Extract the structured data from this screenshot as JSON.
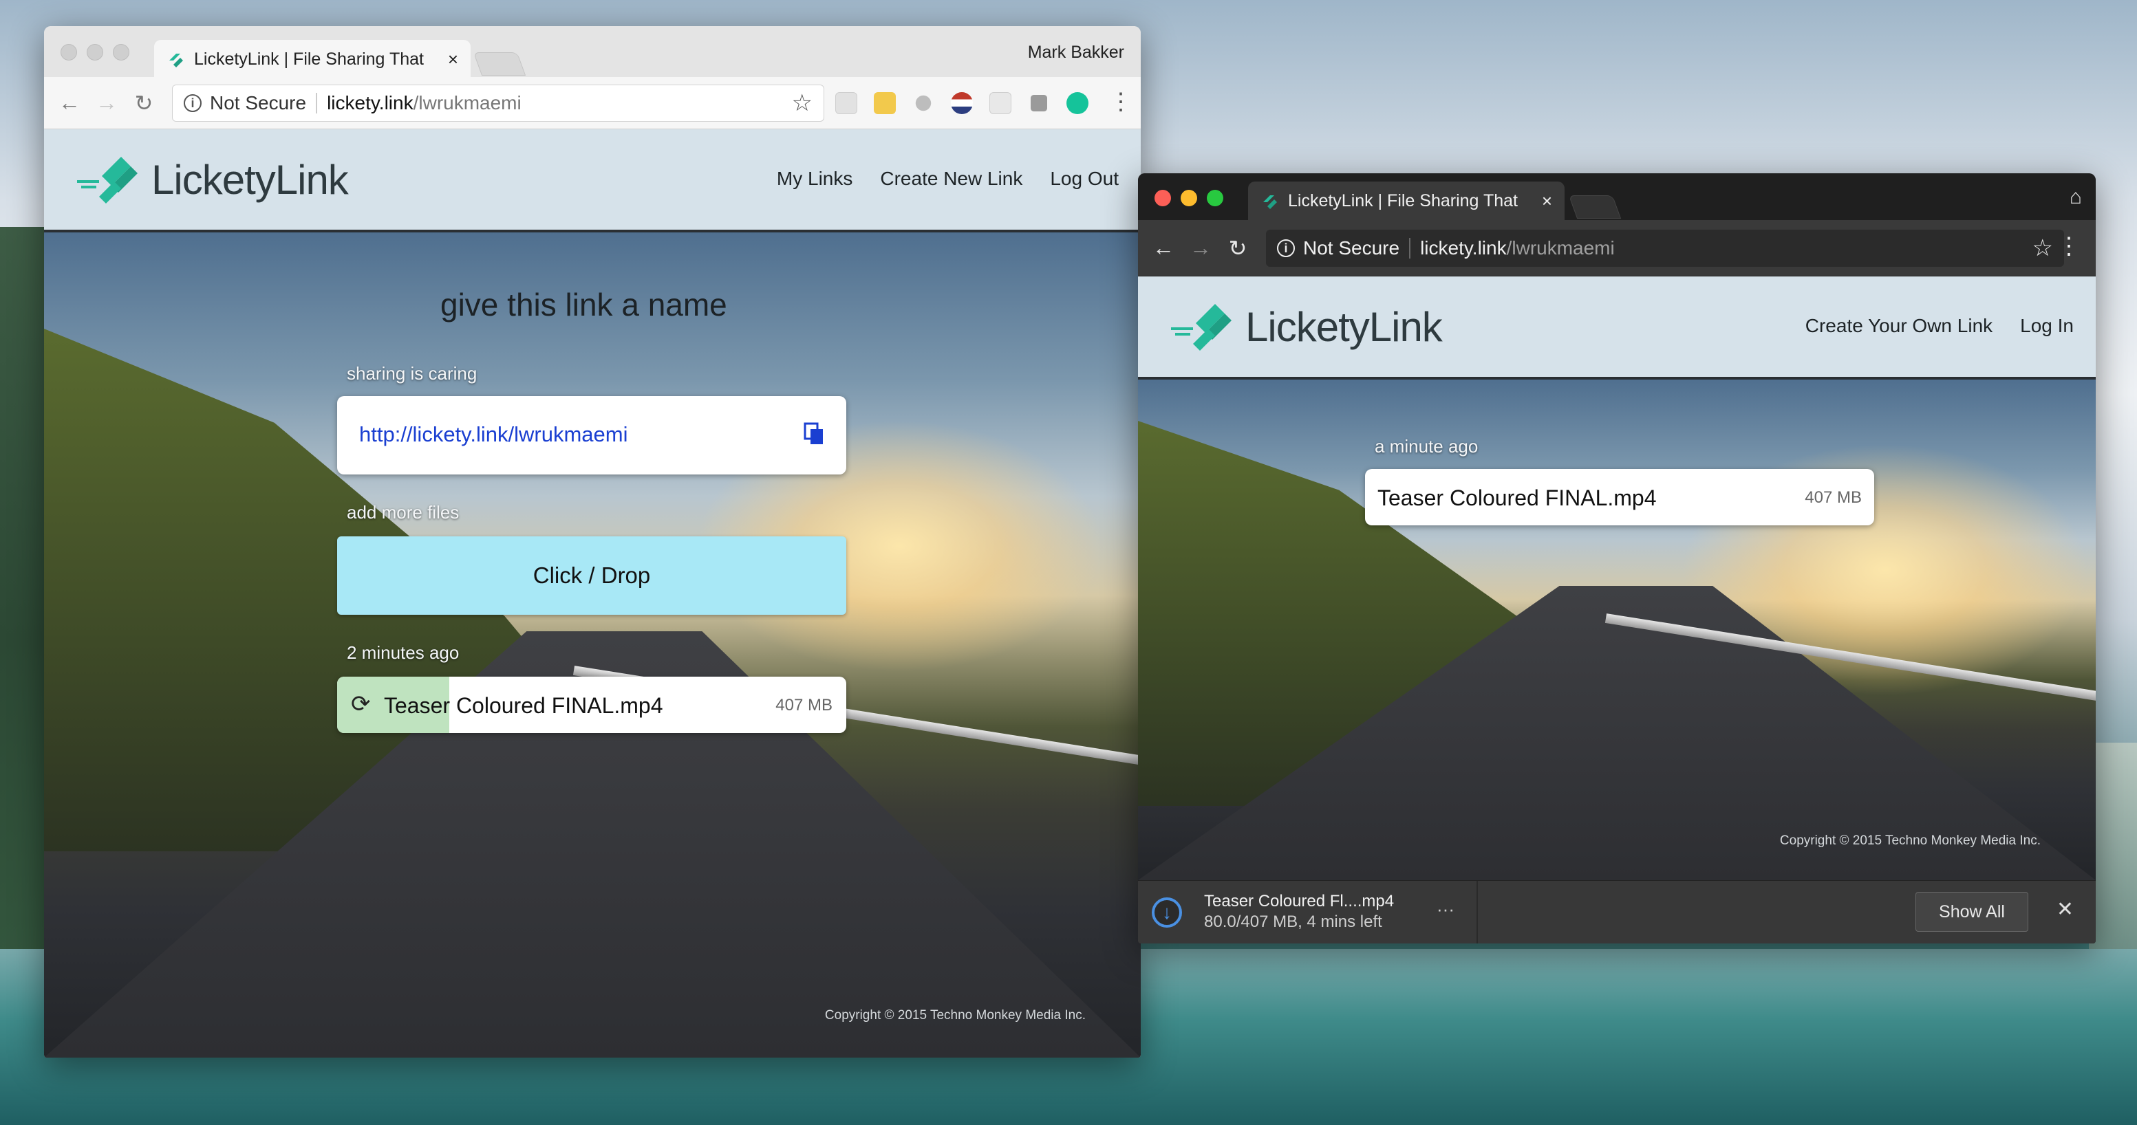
{
  "desktop": {},
  "left_window": {
    "tab_title": "LicketyLink | File Sharing That",
    "tab_close": "×",
    "profile_name": "Mark Bakker",
    "security_label": "Not Secure",
    "url_host": "lickety.link",
    "url_path": "/lwrukmaemi",
    "site": {
      "logo_text": "LicketyLink",
      "nav": [
        "My Links",
        "Create New Link",
        "Log Out"
      ],
      "heading": "give this link a name",
      "share_label": "sharing is caring",
      "share_link": "http://lickety.link/lwrukmaemi",
      "add_label": "add more files",
      "drop_label": "Click / Drop",
      "upload_time": "2 minutes ago",
      "file_name_a": "Teaser",
      "file_name_b": " Coloured FINAL.mp4",
      "file_size": "407 MB",
      "upload_progress_percent": 22,
      "copyright": "Copyright © 2015 Techno Monkey Media Inc."
    }
  },
  "right_window": {
    "tab_title": "LicketyLink | File Sharing That",
    "tab_close": "×",
    "security_label": "Not Secure",
    "url_host": "lickety.link",
    "url_path": "/lwrukmaemi",
    "site": {
      "logo_text": "LicketyLink",
      "nav": [
        "Create Your Own Link",
        "Log In"
      ],
      "upload_time": "a minute ago",
      "file_name": "Teaser Coloured FINAL.mp4",
      "file_size": "407 MB",
      "copyright": "Copyright © 2015 Techno Monkey Media Inc."
    },
    "download_bar": {
      "file_name": "Teaser Coloured Fl....mp4",
      "progress_text": "80.0/407 MB, 4 mins left",
      "more_label": "···",
      "show_all_label": "Show All",
      "close_label": "✕"
    }
  },
  "colors": {
    "brand_teal": "#25b99a",
    "drop_zone": "#a8e8f6",
    "upload_progress": "#bfe3bf",
    "link_blue": "#1a3fd1"
  }
}
